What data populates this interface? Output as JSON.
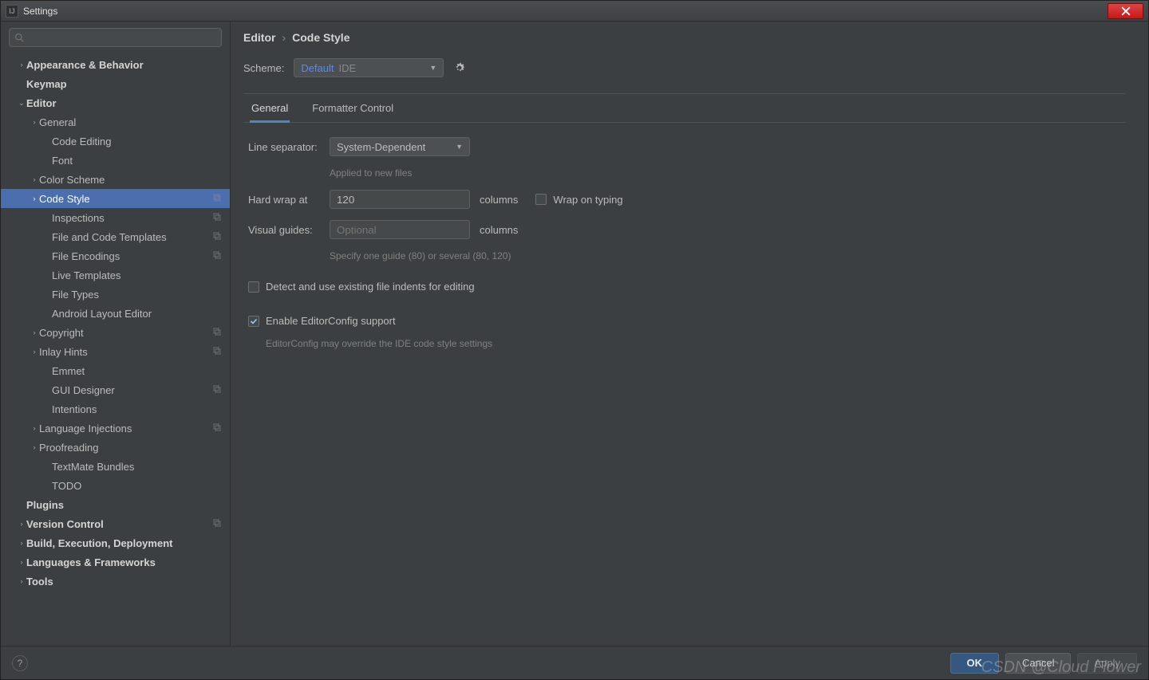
{
  "window": {
    "title": "Settings"
  },
  "search": {
    "placeholder": ""
  },
  "sidebar": [
    {
      "label": "Appearance & Behavior",
      "lvl": 0,
      "arrow": "right",
      "bold": true
    },
    {
      "label": "Keymap",
      "lvl": 0,
      "arrow": "",
      "bold": true
    },
    {
      "label": "Editor",
      "lvl": 0,
      "arrow": "down",
      "bold": true
    },
    {
      "label": "General",
      "lvl": 1,
      "arrow": "right"
    },
    {
      "label": "Code Editing",
      "lvl": 2,
      "arrow": ""
    },
    {
      "label": "Font",
      "lvl": 2,
      "arrow": ""
    },
    {
      "label": "Color Scheme",
      "lvl": 1,
      "arrow": "right"
    },
    {
      "label": "Code Style",
      "lvl": 1,
      "arrow": "right",
      "selected": true,
      "badge": true
    },
    {
      "label": "Inspections",
      "lvl": 2,
      "arrow": "",
      "badge": true
    },
    {
      "label": "File and Code Templates",
      "lvl": 2,
      "arrow": "",
      "badge": true
    },
    {
      "label": "File Encodings",
      "lvl": 2,
      "arrow": "",
      "badge": true
    },
    {
      "label": "Live Templates",
      "lvl": 2,
      "arrow": ""
    },
    {
      "label": "File Types",
      "lvl": 2,
      "arrow": ""
    },
    {
      "label": "Android Layout Editor",
      "lvl": 2,
      "arrow": ""
    },
    {
      "label": "Copyright",
      "lvl": 1,
      "arrow": "right",
      "badge": true
    },
    {
      "label": "Inlay Hints",
      "lvl": 1,
      "arrow": "right",
      "badge": true
    },
    {
      "label": "Emmet",
      "lvl": 2,
      "arrow": ""
    },
    {
      "label": "GUI Designer",
      "lvl": 2,
      "arrow": "",
      "badge": true
    },
    {
      "label": "Intentions",
      "lvl": 2,
      "arrow": ""
    },
    {
      "label": "Language Injections",
      "lvl": 1,
      "arrow": "right",
      "badge": true
    },
    {
      "label": "Proofreading",
      "lvl": 1,
      "arrow": "right"
    },
    {
      "label": "TextMate Bundles",
      "lvl": 2,
      "arrow": ""
    },
    {
      "label": "TODO",
      "lvl": 2,
      "arrow": ""
    },
    {
      "label": "Plugins",
      "lvl": 0,
      "arrow": "",
      "bold": true
    },
    {
      "label": "Version Control",
      "lvl": 0,
      "arrow": "right",
      "bold": true,
      "badge": true
    },
    {
      "label": "Build, Execution, Deployment",
      "lvl": 0,
      "arrow": "right",
      "bold": true
    },
    {
      "label": "Languages & Frameworks",
      "lvl": 0,
      "arrow": "right",
      "bold": true
    },
    {
      "label": "Tools",
      "lvl": 0,
      "arrow": "right",
      "bold": true
    }
  ],
  "breadcrumb": {
    "a": "Editor",
    "b": "Code Style",
    "sep": "›"
  },
  "scheme": {
    "label": "Scheme:",
    "value": "Default",
    "tag": "IDE"
  },
  "tabs": {
    "general": "General",
    "formatter": "Formatter Control"
  },
  "form": {
    "line_sep_label": "Line separator:",
    "line_sep_value": "System-Dependent",
    "line_sep_hint": "Applied to new files",
    "hardwrap_label": "Hard wrap at",
    "hardwrap_value": "120",
    "columns": "columns",
    "wrap_on_typing": "Wrap on typing",
    "visual_label": "Visual guides:",
    "visual_placeholder": "Optional",
    "visual_hint": "Specify one guide (80) or several (80, 120)",
    "detect_label": "Detect and use existing file indents for editing",
    "editorconfig_label": "Enable EditorConfig support",
    "editorconfig_hint": "EditorConfig may override the IDE code style settings"
  },
  "buttons": {
    "ok": "OK",
    "cancel": "Cancel",
    "apply": "Apply"
  },
  "watermark": "CSDN @Cloud Flower"
}
